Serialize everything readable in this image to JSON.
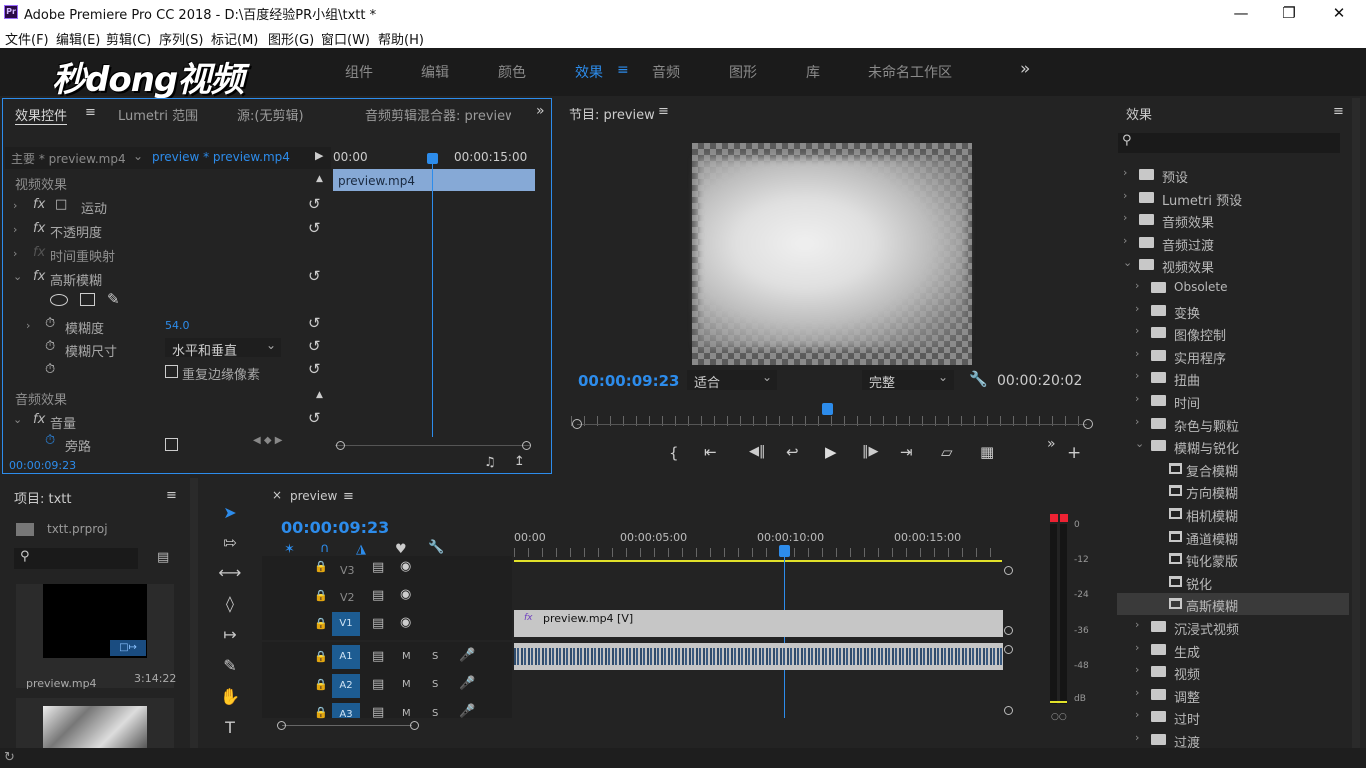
{
  "app": {
    "icon": "Pr",
    "title": "Adobe Premiere Pro CC 2018 - D:\\百度经验PR小组\\txtt *",
    "window_controls": [
      "minimize-icon",
      "maximize-icon",
      "close-icon"
    ]
  },
  "menu": [
    "文件(F)",
    "编辑(E)",
    "剪辑(C)",
    "序列(S)",
    "标记(M)",
    "图形(G)",
    "窗口(W)",
    "帮助(H)"
  ],
  "watermark": "秒dong视频",
  "workspaces": {
    "tabs": [
      "组件",
      "编辑",
      "颜色",
      "效果",
      "音频",
      "图形",
      "库",
      "未命名工作区"
    ],
    "active": "效果",
    "overflow": "»"
  },
  "effect_controls": {
    "tabs": [
      "效果控件",
      "Lumetri 范围",
      "源:(无剪辑)",
      "音频剪辑混合器: preview"
    ],
    "master": "主要 * preview.mp4",
    "clip": "preview * preview.mp4",
    "ruler": [
      "00:00",
      "00:00:15:00"
    ],
    "clip_bar": "preview.mp4",
    "video_header": "视频效果",
    "rows": [
      {
        "label": "运动"
      },
      {
        "label": "不透明度"
      },
      {
        "label": "时间重映射"
      },
      {
        "label": "高斯模糊"
      }
    ],
    "blur_amount_label": "模糊度",
    "blur_amount_value": "54.0",
    "blur_dim_label": "模糊尺寸",
    "blur_dim_value": "水平和垂直",
    "repeat_edge_label": "重复边缘像素",
    "audio_header": "音频效果",
    "volume_label": "音量",
    "bypass_label": "旁路",
    "timecode": "00:00:09:23"
  },
  "program": {
    "title": "节目: preview",
    "timecode": "00:00:09:23",
    "fit": "适合",
    "quality": "完整",
    "duration": "00:00:20:02",
    "playhead_fraction": 0.49
  },
  "effects_panel": {
    "title": "效果",
    "search_placeholder": "",
    "items": [
      {
        "label": "预设",
        "level": 0,
        "open": false
      },
      {
        "label": "Lumetri 预设",
        "level": 0,
        "open": false
      },
      {
        "label": "音频效果",
        "level": 0,
        "open": false
      },
      {
        "label": "音频过渡",
        "level": 0,
        "open": false
      },
      {
        "label": "视频效果",
        "level": 0,
        "open": true
      },
      {
        "label": "Obsolete",
        "level": 1,
        "open": false
      },
      {
        "label": "变换",
        "level": 1,
        "open": false
      },
      {
        "label": "图像控制",
        "level": 1,
        "open": false
      },
      {
        "label": "实用程序",
        "level": 1,
        "open": false
      },
      {
        "label": "扭曲",
        "level": 1,
        "open": false
      },
      {
        "label": "时间",
        "level": 1,
        "open": false
      },
      {
        "label": "杂色与颗粒",
        "level": 1,
        "open": false
      },
      {
        "label": "模糊与锐化",
        "level": 1,
        "open": true
      },
      {
        "label": "复合模糊",
        "level": 2
      },
      {
        "label": "方向模糊",
        "level": 2
      },
      {
        "label": "相机模糊",
        "level": 2
      },
      {
        "label": "通道模糊",
        "level": 2
      },
      {
        "label": "钝化蒙版",
        "level": 2
      },
      {
        "label": "锐化",
        "level": 2
      },
      {
        "label": "高斯模糊",
        "level": 2,
        "selected": true
      },
      {
        "label": "沉浸式视频",
        "level": 1,
        "open": false
      },
      {
        "label": "生成",
        "level": 1,
        "open": false
      },
      {
        "label": "视频",
        "level": 1,
        "open": false
      },
      {
        "label": "调整",
        "level": 1,
        "open": false
      },
      {
        "label": "过时",
        "level": 1,
        "open": false
      },
      {
        "label": "过渡",
        "level": 1,
        "open": false
      }
    ]
  },
  "project": {
    "title": "项目: txtt",
    "file": "txtt.prproj",
    "clip_name": "preview.mp4",
    "clip_duration": "3:14:22"
  },
  "timeline": {
    "tab": "preview",
    "timecode": "00:00:09:23",
    "ruler": [
      "00:00",
      "00:00:05:00",
      "00:00:10:00",
      "00:00:15:00"
    ],
    "video_tracks": [
      "V3",
      "V2",
      "V1"
    ],
    "audio_tracks": [
      "A1",
      "A2",
      "A3"
    ],
    "clip_label": "preview.mp4 [V]",
    "m_label": "M",
    "s_label": "S"
  },
  "meter": {
    "scale": [
      "0",
      "-12",
      "-24",
      "-36",
      "-48",
      "dB"
    ]
  }
}
